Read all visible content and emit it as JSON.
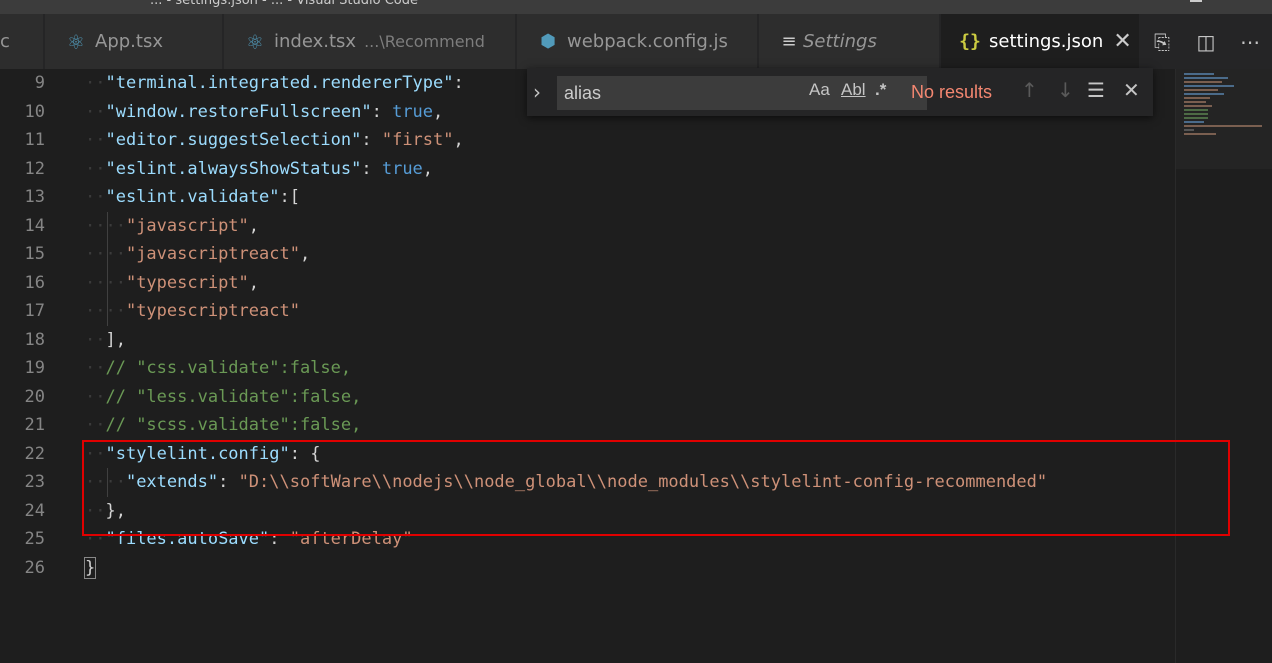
{
  "window": {
    "title_fragment": "... - settings.json - ... - Visual Studio Code"
  },
  "tabs": [
    {
      "label": "c",
      "icon": "react-icon"
    },
    {
      "label": "App.tsx",
      "icon": "react-icon"
    },
    {
      "label": "index.tsx",
      "path": "...\\Recommend",
      "icon": "react-icon"
    },
    {
      "label": "webpack.config.js",
      "icon": "cube-icon"
    },
    {
      "label": "Settings",
      "icon": "lines-icon"
    },
    {
      "label": "settings.json",
      "icon": "braces-icon",
      "active": true,
      "close": "✕"
    }
  ],
  "tab_actions": {
    "open_changes": "⎘",
    "split": "◫",
    "more": "⋯"
  },
  "find": {
    "toggle": "›",
    "query": "alias",
    "match_case": "Aa",
    "whole_word": "Abl",
    "regex": ".*",
    "status": "No results",
    "prev": "↑",
    "next": "↓",
    "in_selection": "☰",
    "close": "✕"
  },
  "line_numbers": [
    "9",
    "10",
    "11",
    "12",
    "13",
    "14",
    "15",
    "16",
    "17",
    "18",
    "19",
    "20",
    "21",
    "22",
    "23",
    "24",
    "25",
    "26"
  ],
  "code": {
    "l9": {
      "key": "\"terminal.integrated.rendererType\"",
      "punct": ":"
    },
    "l10": {
      "key": "\"window.restoreFullscreen\"",
      "punct": ": ",
      "val": "true",
      "end": ","
    },
    "l11": {
      "key": "\"editor.suggestSelection\"",
      "punct": ": ",
      "val": "\"first\"",
      "end": ","
    },
    "l12": {
      "key": "\"eslint.alwaysShowStatus\"",
      "punct": ": ",
      "val": "true",
      "end": ","
    },
    "l13": {
      "key": "\"eslint.validate\"",
      "punct": ":["
    },
    "l14": {
      "val": "\"javascript\"",
      "end": ","
    },
    "l15": {
      "val": "\"javascriptreact\"",
      "end": ","
    },
    "l16": {
      "val": "\"typescript\"",
      "end": ","
    },
    "l17": {
      "val": "\"typescriptreact\""
    },
    "l18": {
      "punct": "],"
    },
    "l19": {
      "comment": "// \"css.validate\":false,"
    },
    "l20": {
      "comment": "// \"less.validate\":false,"
    },
    "l21": {
      "comment": "// \"scss.validate\":false,"
    },
    "l22": {
      "key": "\"stylelint.config\"",
      "punct": ": {"
    },
    "l23": {
      "key": "\"extends\"",
      "punct": ": ",
      "val": "\"D:\\\\softWare\\\\nodejs\\\\node_global\\\\node_modules\\\\stylelint-config-recommended\""
    },
    "l24": {
      "punct": "},"
    },
    "l25": {
      "key": "\"files.autoSave\"",
      "punct": ": ",
      "val": "\"afterDelay\""
    },
    "l26": {
      "punct": "}"
    }
  },
  "colors": {
    "key": "#9cdcfe",
    "string": "#ce9178",
    "boolean": "#569cd6",
    "comment": "#6a9955",
    "annotation": "#e00000",
    "no_results": "#f48771"
  }
}
